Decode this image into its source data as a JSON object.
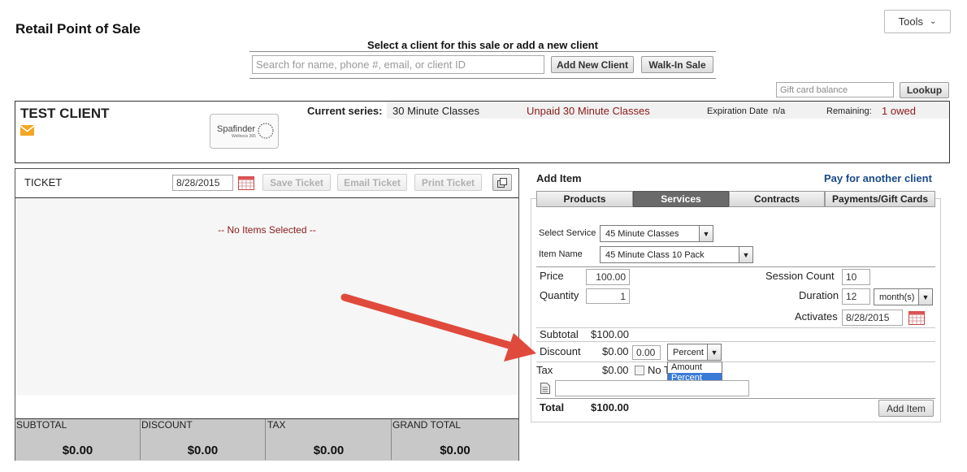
{
  "page": {
    "title": "Retail Point of Sale",
    "tools_label": "Tools"
  },
  "client_select": {
    "heading": "Select a client for this sale or add a new client",
    "search_placeholder": "Search for name, phone #, email, or client ID",
    "add_new_label": "Add New Client",
    "walkin_label": "Walk-In Sale"
  },
  "giftcard": {
    "placeholder": "Gift card balance",
    "lookup_label": "Lookup"
  },
  "client": {
    "name": "TEST CLIENT",
    "logo_line1": "Spafinder",
    "logo_line2": "Wellness 365",
    "current_series_label": "Current series:",
    "current_series_value": "30 Minute Classes",
    "unpaid_text": "Unpaid 30 Minute Classes",
    "expiration_label": "Expiration Date",
    "expiration_value": "n/a",
    "remaining_label": "Remaining:",
    "remaining_value": "1 owed"
  },
  "ticket": {
    "title": "TICKET",
    "date": "8/28/2015",
    "save_label": "Save Ticket",
    "email_label": "Email Ticket",
    "print_label": "Print Ticket",
    "empty_text": "-- No Items Selected --",
    "totals": [
      {
        "label": "SUBTOTAL",
        "value": "$0.00"
      },
      {
        "label": "DISCOUNT",
        "value": "$0.00"
      },
      {
        "label": "TAX",
        "value": "$0.00"
      },
      {
        "label": "GRAND TOTAL",
        "value": "$0.00"
      }
    ]
  },
  "add_item": {
    "title": "Add Item",
    "pay_another": "Pay for another client",
    "tabs": [
      "Products",
      "Services",
      "Contracts",
      "Payments/Gift Cards"
    ],
    "active_tab": "Services",
    "select_service_label": "Select Service",
    "select_service_value": "45 Minute Classes",
    "item_name_label": "Item Name",
    "item_name_value": "45 Minute Class 10 Pack",
    "price_label": "Price",
    "price_value": "100.00",
    "quantity_label": "Quantity",
    "quantity_value": "1",
    "session_count_label": "Session Count",
    "session_count_value": "10",
    "duration_label": "Duration",
    "duration_value": "12",
    "duration_unit": "month(s)",
    "activates_label": "Activates",
    "activates_value": "8/28/2015",
    "subtotal_label": "Subtotal",
    "subtotal_value": "$100.00",
    "discount_label": "Discount",
    "discount_value": "$0.00",
    "discount_input": "0.00",
    "discount_type": "Percent",
    "discount_options": [
      "Amount",
      "Percent"
    ],
    "tax_label": "Tax",
    "tax_value": "$0.00",
    "no_tax_label": "No T",
    "total_label": "Total",
    "total_value": "$100.00",
    "add_item_label": "Add Item"
  },
  "colors": {
    "client_name": "#1a3e6e",
    "unpaid": "#8b1a1a",
    "link": "#1a4a8a",
    "active_tab": "#6a6a6a",
    "arrow": "#e04a3c"
  }
}
